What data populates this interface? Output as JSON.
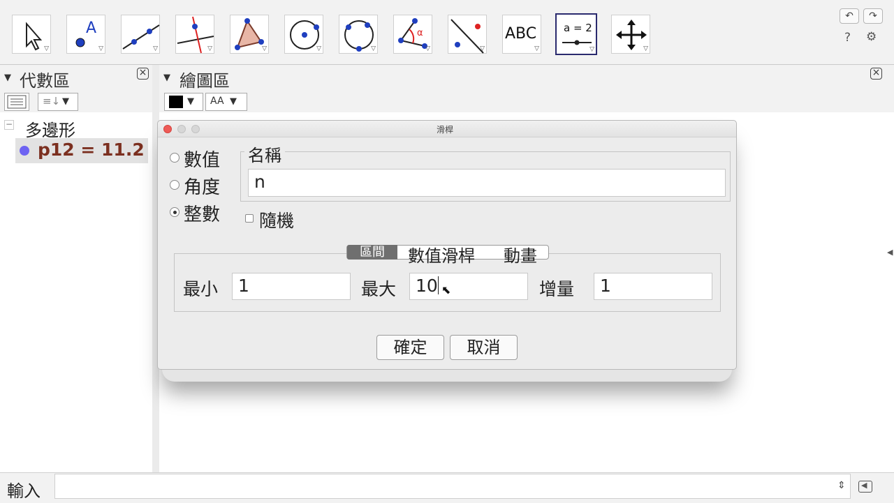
{
  "toolbar": {
    "tools": [
      {
        "icon": "move-arrow-icon"
      },
      {
        "icon": "point-icon",
        "label": "A"
      },
      {
        "icon": "line-icon"
      },
      {
        "icon": "perpendicular-line-icon"
      },
      {
        "icon": "polygon-icon"
      },
      {
        "icon": "circle-center-point-icon"
      },
      {
        "icon": "circle-three-points-icon"
      },
      {
        "icon": "angle-icon",
        "label": "α"
      },
      {
        "icon": "reflect-icon"
      },
      {
        "icon": "text-icon",
        "label": "ABC"
      },
      {
        "icon": "slider-icon",
        "label": "a = 2"
      },
      {
        "icon": "move-graphics-view-icon"
      }
    ],
    "help_label": "?",
    "settings_label": "⚙"
  },
  "algebra_panel": {
    "title": "代數區",
    "group_label": "多邊形",
    "item": "p12 = 11.2",
    "item_color": "#7b2f1f",
    "dot_color": "#6e63f2"
  },
  "graphics_panel": {
    "title": "繪圖區",
    "color_swatch": "#000000",
    "text_style_label": "AA"
  },
  "input_bar": {
    "label": "輸入",
    "dropdown": "⇕"
  },
  "dialog": {
    "title": "滑桿",
    "types": [
      {
        "label": "數值",
        "selected": false
      },
      {
        "label": "角度",
        "selected": false
      },
      {
        "label": "整數",
        "selected": true
      }
    ],
    "name_label": "名稱",
    "name_value": "n",
    "random_label": "隨機",
    "tabs": [
      "區間",
      "數值滑桿",
      "動畫"
    ],
    "min_label": "最小",
    "min_value": "1",
    "max_label": "最大",
    "max_value": "10",
    "increment_label": "增量",
    "increment_value": "1",
    "ok_label": "確定",
    "cancel_label": "取消"
  },
  "colors": {
    "accent": "#2a2a6e",
    "point_blue": "#1f3fbf"
  }
}
